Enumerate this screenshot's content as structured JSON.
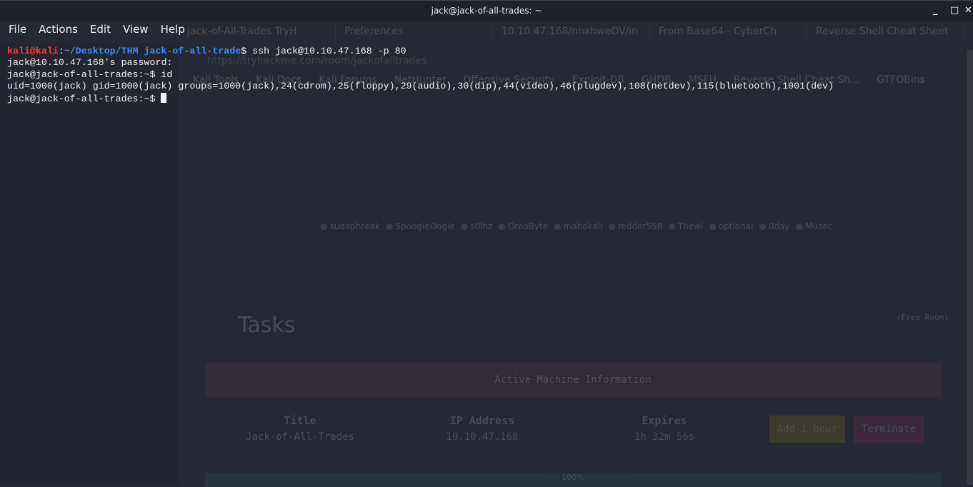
{
  "window": {
    "title": "jack@jack-of-all-trades: ~",
    "minimize": "_",
    "maximize": "□",
    "close": "✕"
  },
  "menu": [
    "File",
    "Actions",
    "Edit",
    "View",
    "Help"
  ],
  "terminal": {
    "prompt1_user": "kali@kali",
    "prompt1_sep": ":",
    "prompt1_path": "~/Desktop/THM jack-of-all-trade",
    "prompt1_cmd": "$ ssh jack@10.10.47.168 -p 80",
    "lines": [
      "jack@10.10.47.168's password:",
      "jack@jack-of-all-trades:~$ id",
      "uid=1000(jack) gid=1000(jack) groups=1000(jack),24(cdrom),25(floppy),29(audio),30(dip),44(video),46(plugdev),108(netdev),115(bluetooth),1001(dev)"
    ],
    "current_prompt": "jack@jack-of-all-trades:~$ "
  },
  "background_browser": {
    "tabs": [
      "Jack-of-All-Trades TryH",
      "Preferences",
      "10.10.47.168/nnxhweOV/in",
      "From Base64 - CyberCh",
      "Reverse Shell Cheat Sheet"
    ],
    "url": "https://tryhackme.com/room/jackofalltrades",
    "bookmarks": [
      "Kali Tools",
      "Kali Docs",
      "Kali Forums",
      "NetHunter",
      "Offensive Security",
      "Exploit-DB",
      "GHDB",
      "MSFU",
      "Reverse Shell Cheat Sh...",
      "GTFOBins"
    ],
    "legend": [
      "sudophreak",
      "SpoogieOogie",
      "s0lhz",
      "OreoByte",
      "mahakali",
      "redder558",
      "Thewl",
      "optional",
      "0day",
      "Muzec"
    ],
    "tasks_title": "Tasks",
    "free_room": "(Free Room)",
    "machine_header": "Active Machine Information",
    "columns": [
      {
        "label": "Title",
        "value": "Jack-of-All-Trades"
      },
      {
        "label": "IP Address",
        "value": "10.10.47.168"
      },
      {
        "label": "Expires",
        "value": "1h 32m 56s"
      }
    ],
    "add_hour": "Add 1 hour",
    "terminate": "Terminate",
    "progress": "100%"
  }
}
